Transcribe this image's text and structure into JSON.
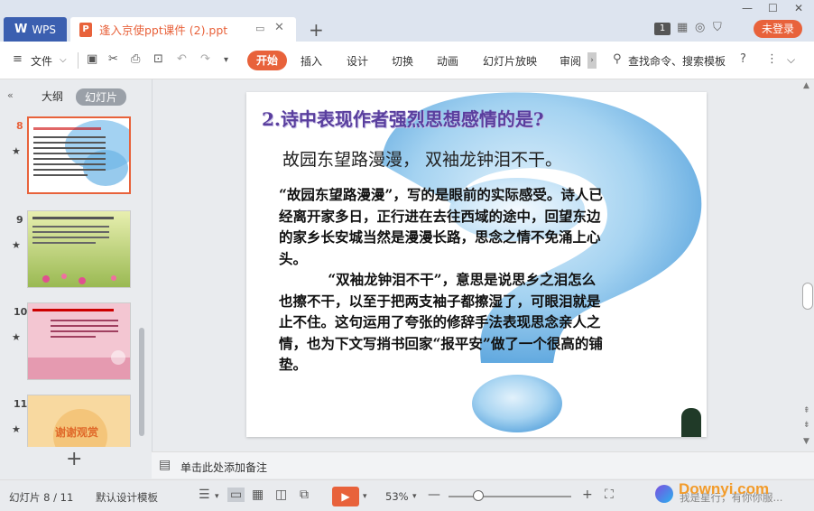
{
  "window": {
    "app_tab": "WPS",
    "doc_tab_title": "逢入京使ppt课件 (2).ppt",
    "page_badge": "1",
    "login_label": "未登录"
  },
  "menu": {
    "file_label": "文件",
    "tabs": [
      "开始",
      "插入",
      "设计",
      "切换",
      "动画",
      "幻灯片放映",
      "审阅"
    ],
    "search_label": "查找命令、搜索模板"
  },
  "panel": {
    "tab_outline": "大纲",
    "tab_slides": "幻灯片",
    "thumbs": [
      {
        "num": "8",
        "title": "1.中年人 ...",
        "active": true
      },
      {
        "num": "9",
        "title": "2.作者通入 ...",
        "active": false
      },
      {
        "num": "10",
        "title": "3.诗中表达了作者怎样的思想感情?",
        "active": false
      },
      {
        "num": "11",
        "title": "谢谢观赏",
        "active": false
      }
    ]
  },
  "slide": {
    "title": "2.诗中表现作者强烈思想感情的是?",
    "subtitle": "故园东望路漫漫，   双袖龙钟泪不干。",
    "para1": "“故园东望路漫漫”，写的是眼前的实际感受。诗人已经离开家多日，正行进在去往西域的途中，回望东边的家乡长安城当然是漫漫长路，思念之情不免涌上心头。",
    "para2": "“双袖龙钟泪不干”，意思是说思乡之泪怎么也擦不干，以至于把两支袖子都擦湿了，可眼泪就是止不住。这句运用了夸张的修辞手法表现思念亲人之情，也为下文写捎书回家“报平安”做了一个很高的铺垫。"
  },
  "notes": {
    "placeholder": "单击此处添加备注"
  },
  "status": {
    "slide_counter": "幻灯片 8 / 11",
    "template": "默认设计模板",
    "zoom": "53%",
    "assistant_text": "我是星行，有你你服...",
    "watermark": "Downyi.com"
  },
  "colors": {
    "accent": "#e8623b",
    "wps_blue": "#3b5fb0",
    "title_purple": "#5a3f9e"
  }
}
